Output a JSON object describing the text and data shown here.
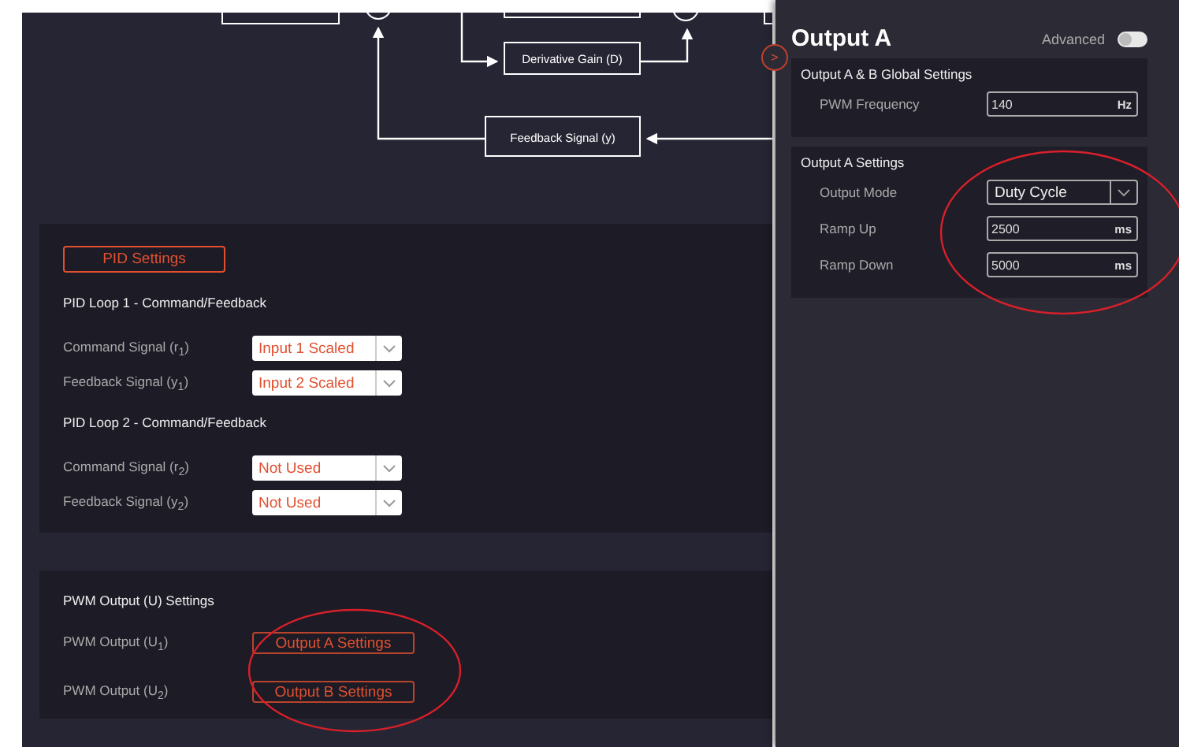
{
  "diagram": {
    "blocks": [
      {
        "label": "Derivative Gain (D)"
      },
      {
        "label": "Feedback Signal (y)"
      }
    ]
  },
  "pid_settings": {
    "button": "PID Settings",
    "loops": [
      {
        "title": "PID Loop 1 - Command/Feedback",
        "rows": [
          {
            "label": "Command Signal (r$_{1}$)",
            "value": "Input 1 Scaled"
          },
          {
            "label": "Feedback Signal (y$_{1}$)",
            "value": "Input 2 Scaled"
          }
        ]
      },
      {
        "title": "PID Loop 2 - Command/Feedback",
        "rows": [
          {
            "label": "Command Signal (r$_{2}$)",
            "value": "Not Used"
          },
          {
            "label": "Feedback Signal (y$_{2}$)",
            "value": "Not Used"
          }
        ]
      }
    ]
  },
  "pwm_output": {
    "title": "PWM Output (U) Settings",
    "circled": true,
    "rows": [
      {
        "label": "PWM Output (U$_{1}$)",
        "button": "Output A Settings"
      },
      {
        "label": "PWM Output (U$_{2}$)",
        "button": "Output B Settings"
      }
    ]
  },
  "panel": {
    "collapse_button": ">",
    "title": "Output A",
    "advanced": {
      "label": "Advanced",
      "on": false
    },
    "sections": [
      {
        "title": "Output A & B Global Settings",
        "circled": false,
        "fields": [
          {
            "kind": "input",
            "label": "PWM Frequency",
            "value": "140",
            "unit": "Hz"
          }
        ]
      },
      {
        "title": "Output A Settings",
        "circled": true,
        "fields": [
          {
            "kind": "select",
            "label": "Output Mode",
            "value": "Duty Cycle"
          },
          {
            "kind": "input",
            "label": "Ramp Up",
            "value": "2500",
            "unit": "ms"
          },
          {
            "kind": "input",
            "label": "Ramp Down",
            "value": "5000",
            "unit": "ms"
          }
        ]
      }
    ]
  }
}
